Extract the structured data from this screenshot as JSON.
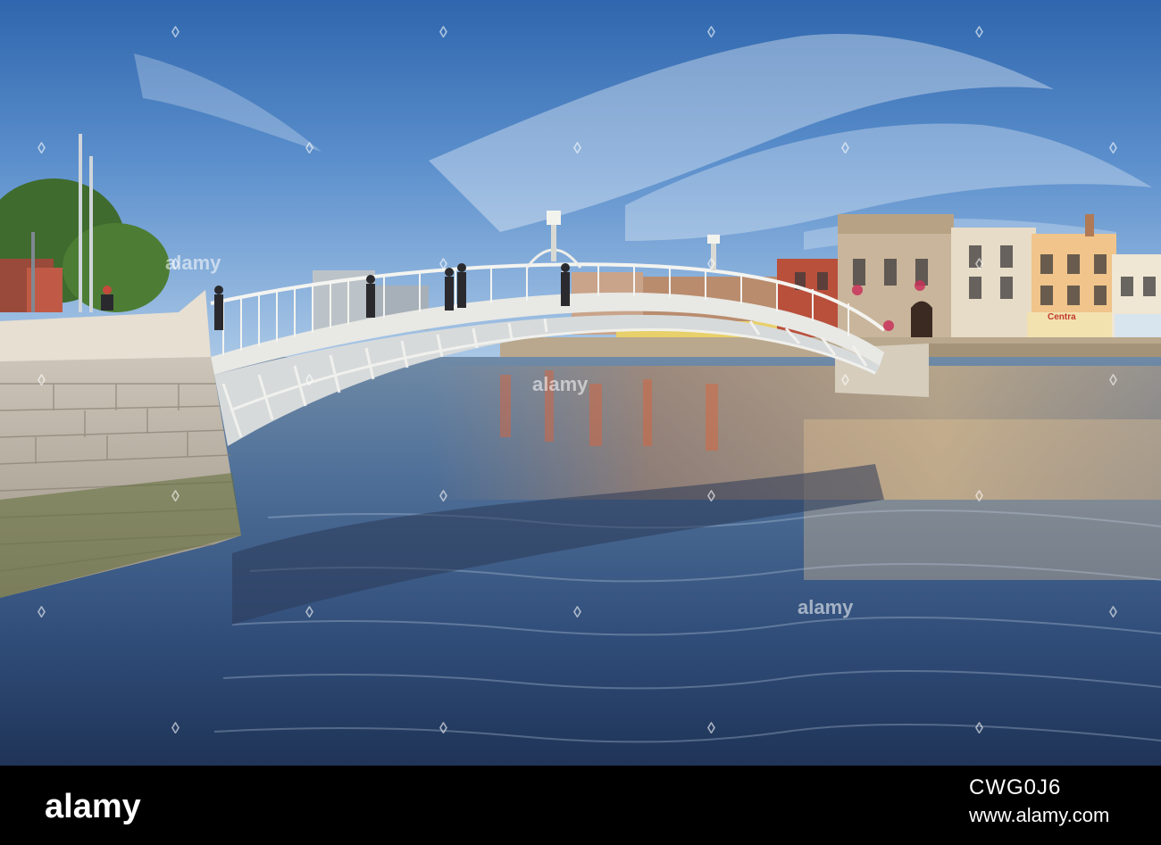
{
  "photo": {
    "subject": "ha-penny-bridge-river-scene",
    "shop_signs": [
      "Centra"
    ]
  },
  "footer": {
    "brand": "alamy",
    "stock_id": "CWG0J6",
    "url": "www.alamy.com"
  },
  "watermark": {
    "text": "alamy"
  }
}
